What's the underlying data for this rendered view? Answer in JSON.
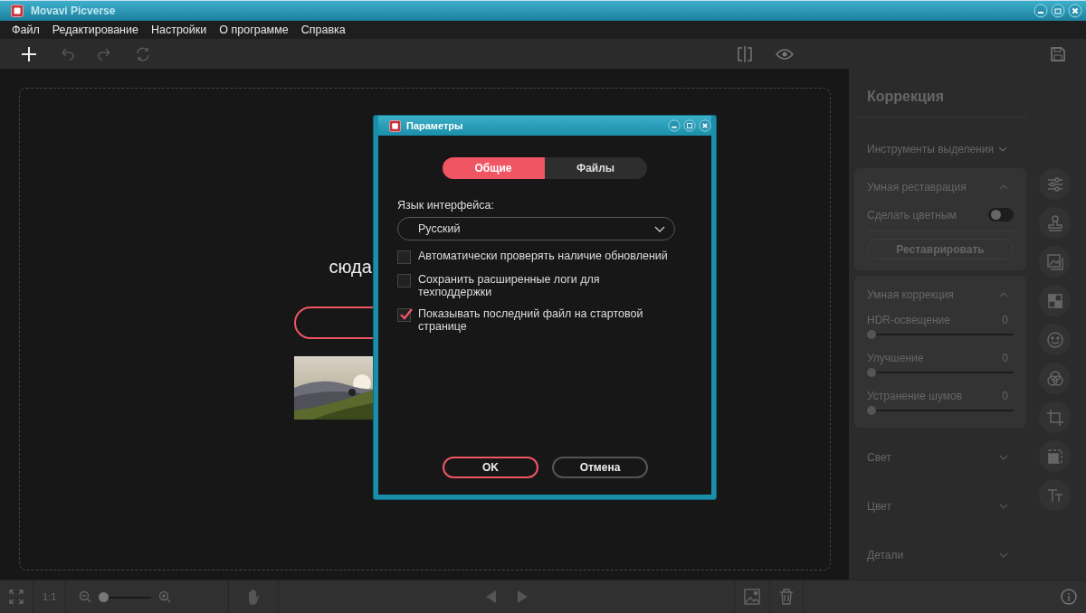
{
  "window": {
    "title": "Movavi Picverse"
  },
  "menu": [
    "Файл",
    "Редактирование",
    "Настройки",
    "О программе",
    "Справка"
  ],
  "canvas": {
    "subheading_fragment": "сюда"
  },
  "panel": {
    "title": "Коррекция",
    "sections": [
      {
        "kind": "inline",
        "title": "Инструменты выделения",
        "expanded": false
      },
      {
        "kind": "card",
        "title": "Умная реставрация",
        "expanded": true,
        "items": [
          {
            "kind": "toggle",
            "label": "Сделать цветным",
            "on": false
          },
          {
            "kind": "button",
            "label": "Реставрировать"
          }
        ]
      },
      {
        "kind": "card",
        "title": "Умная коррекция",
        "expanded": true,
        "items": [
          {
            "kind": "slider",
            "label": "HDR-освещение",
            "reading": "0",
            "level": 0
          },
          {
            "kind": "slider",
            "label": "Улучшение",
            "reading": "0",
            "level": 0
          },
          {
            "kind": "slider",
            "label": "Устранение шумов",
            "reading": "0",
            "level": 0
          }
        ]
      },
      {
        "kind": "row",
        "title": "Свет",
        "expanded": false
      },
      {
        "kind": "row",
        "title": "Цвет",
        "expanded": false
      },
      {
        "kind": "row",
        "title": "Детали",
        "expanded": false
      }
    ]
  },
  "bottom_bar": {
    "zoom_label": "1:1",
    "zoom": {
      "level": 0
    }
  },
  "dialog": {
    "title": "Параметры",
    "tabs": [
      {
        "label": "Общие",
        "selected": true
      },
      {
        "label": "Файлы",
        "selected": false
      }
    ],
    "language_label": "Язык интерфейса:",
    "language": "Русский",
    "options": [
      {
        "label": "Автоматически проверять наличие обновлений",
        "checked": false
      },
      {
        "label": "Сохранить расширенные логи для техподдержки",
        "checked": false
      },
      {
        "label": "Показывать последний файл на стартовой странице",
        "checked": true
      }
    ],
    "buttons": [
      {
        "label": "OK",
        "kind": "primary"
      },
      {
        "label": "Отмена",
        "kind": "secondary"
      }
    ]
  }
}
